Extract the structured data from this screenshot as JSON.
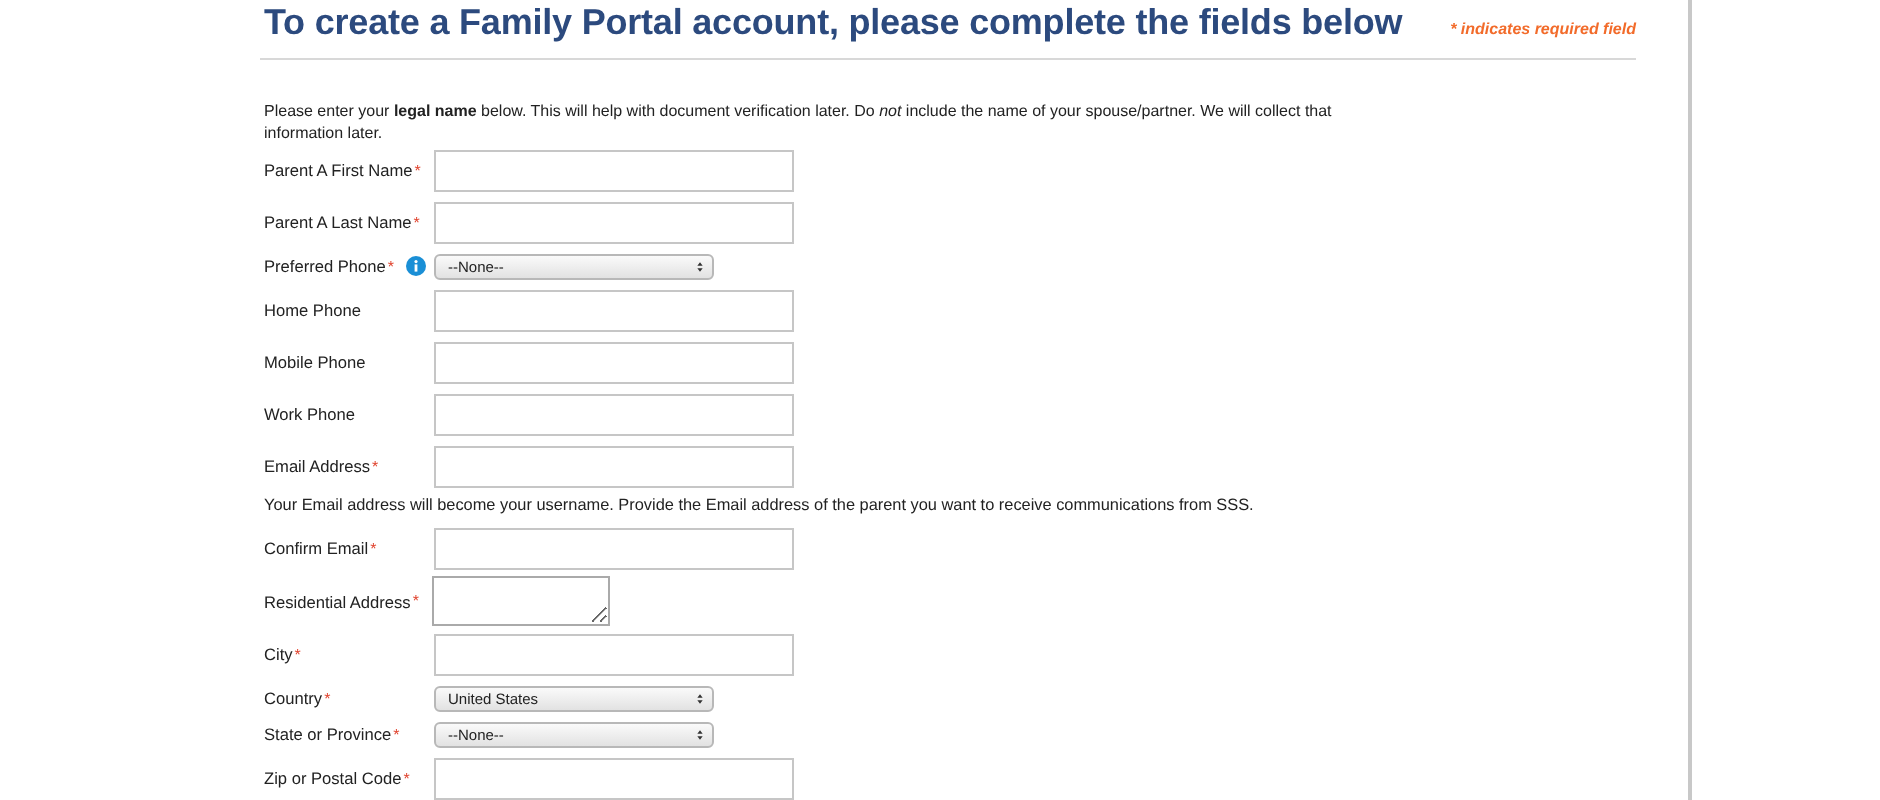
{
  "header": {
    "title": "To create a Family Portal account, please complete the fields below",
    "required_note": "* indicates required field"
  },
  "intro": "Please enter your **legal name** below. This will help with document verification later. Do *not* include the name of your spouse/partner. We will collect that information later.",
  "rows": [
    {
      "kind": "text",
      "label": "Parent A First Name",
      "required_mark": "*"
    },
    {
      "kind": "text",
      "label": "Parent A Last Name",
      "required_mark": "*"
    },
    {
      "kind": "select",
      "label": "Preferred Phone",
      "required_mark": "*",
      "info": true,
      "value": "--None--"
    },
    {
      "kind": "text",
      "label": "Home Phone"
    },
    {
      "kind": "text",
      "label": "Mobile Phone"
    },
    {
      "kind": "text",
      "label": "Work Phone"
    },
    {
      "kind": "text",
      "label": "Email Address",
      "required_mark": "*"
    },
    {
      "kind": "note",
      "text": "Your Email address will become your username. Provide the Email address of the parent you want to receive communications from SSS."
    },
    {
      "kind": "text",
      "label": "Confirm Email",
      "required_mark": "*"
    },
    {
      "kind": "textarea",
      "label": "Residential Address",
      "required_mark": "*"
    },
    {
      "kind": "text",
      "label": "City",
      "required_mark": "*"
    },
    {
      "kind": "select",
      "label": "Country",
      "required_mark": "*",
      "value": "United States"
    },
    {
      "kind": "select",
      "label": "State or Province",
      "required_mark": "*",
      "value": "--None--"
    },
    {
      "kind": "text",
      "label": "Zip or Postal Code",
      "required_mark": "*"
    }
  ]
}
